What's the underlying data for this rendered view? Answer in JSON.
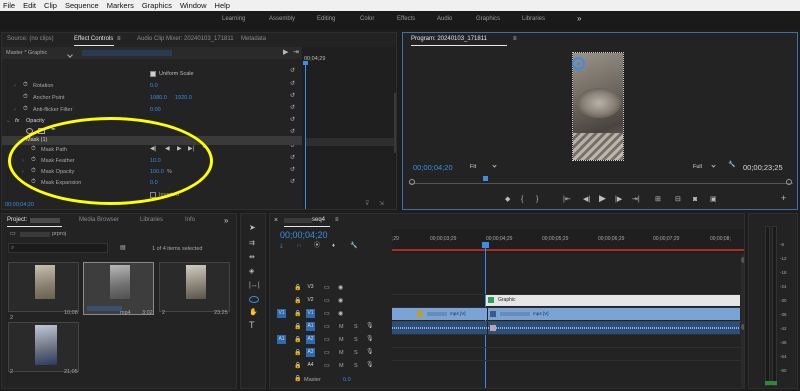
{
  "menu": [
    "File",
    "Edit",
    "Clip",
    "Sequence",
    "Markers",
    "Graphics",
    "Window",
    "Help"
  ],
  "workspaces": [
    "Learning",
    "Assembly",
    "Editing",
    "Color",
    "Effects",
    "Audio",
    "Graphics",
    "Libraries"
  ],
  "workspace_more": "»",
  "source_tabs": {
    "source": "Source: (no clips)",
    "effect_controls": "Effect Controls",
    "menu_icon": "≡",
    "audio_mixer": "Audio Clip Mixer: 20240103_171811",
    "metadata": "Metadata"
  },
  "effect_controls": {
    "master": "Master * Graphic",
    "timecode_start": "00;04;29",
    "uniform_scale": "Uniform Scale",
    "rotation": {
      "label": "Rotation",
      "value": "0.0"
    },
    "anchor": {
      "label": "Anchor Point",
      "x": "1080.0",
      "y": "1920.0"
    },
    "antiflicker": {
      "label": "Anti-flicker Filter",
      "value": "0.00"
    },
    "opacity_label": "Opacity",
    "mask_label": "Mask (1)",
    "mask_path": "Mask Path",
    "mask_feather": {
      "label": "Mask Feather",
      "value": "10.0"
    },
    "mask_opacity": {
      "label": "Mask Opacity",
      "value": "100.0",
      "unit": "%"
    },
    "mask_expansion": {
      "label": "Mask Expansion",
      "value": "0.0"
    },
    "inverted": "Inverted",
    "timecode": "00;00;04;20"
  },
  "program": {
    "title": "Program: 20240103_171811",
    "timecode": "00;00;04;20",
    "fit": "Fit",
    "full": "Full",
    "duration": "00;00;23;25"
  },
  "project": {
    "tabs": [
      "Project:",
      "Media Browser",
      "Libraries",
      "Info"
    ],
    "more": "»",
    "name": "prproj",
    "count": "1 of 4 items selected",
    "items": [
      {
        "name": "2",
        "duration": "10;08"
      },
      {
        "name": "mp4",
        "duration": "3;02"
      },
      {
        "name": "2",
        "duration": "23;25"
      },
      {
        "name": "2",
        "duration": "21;05"
      }
    ]
  },
  "timeline": {
    "tab": "seq4",
    "timecode": "00;00;04;20",
    "ruler": [
      ";29",
      "00;00;03;29",
      "00;00;04;29",
      "00;00;05;29",
      "00;00;06;29",
      "00;00;07;29",
      "00;00;08;"
    ],
    "tracks": [
      {
        "name": "V3",
        "src": "",
        "kind": "video"
      },
      {
        "name": "V2",
        "src": "",
        "kind": "video"
      },
      {
        "name": "V1",
        "src": "V1",
        "kind": "video"
      },
      {
        "name": "A1",
        "src": "A1",
        "kind": "audio"
      },
      {
        "name": "A2",
        "src": "",
        "kind": "audio"
      },
      {
        "name": "A3",
        "src": "",
        "kind": "audio"
      },
      {
        "name": "A4",
        "src": "",
        "kind": "audio"
      }
    ],
    "master": {
      "label": "Master",
      "value": "0.0"
    },
    "graphic_clip": "Graphic",
    "clip_a": "mp4 [V]",
    "clip_b": "mp4 [V]"
  },
  "meter_scale": [
    "-6",
    "-12",
    "-18",
    "-24",
    "-30",
    "-36",
    "-42",
    "-48",
    "-54",
    "-60"
  ],
  "colors": {
    "accent": "#3a8ee6",
    "playhead": "#3a8ee6",
    "highlight": "#ffff00",
    "graphic": "#e6e6e6"
  }
}
